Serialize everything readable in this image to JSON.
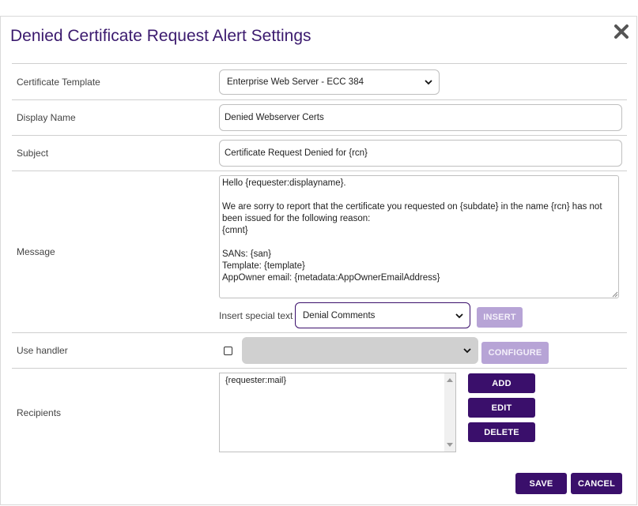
{
  "dialog": {
    "title": "Denied Certificate Request Alert Settings"
  },
  "fields": {
    "certificate_template": {
      "label": "Certificate Template",
      "value": "Enterprise Web Server - ECC 384"
    },
    "display_name": {
      "label": "Display Name",
      "value": "Denied Webserver Certs"
    },
    "subject": {
      "label": "Subject",
      "value": "Certificate Request Denied for {rcn}"
    },
    "message": {
      "label": "Message",
      "value": "Hello {requester:displayname}.\n\nWe are sorry to report that the certificate you requested on {subdate} in the name {rcn} has not been issued for the following reason:\n{cmnt}\n\nSANs: {san}\nTemplate: {template}\nAppOwner email: {metadata:AppOwnerEmailAddress}"
    },
    "insert_special": {
      "label": "Insert special text",
      "value": "Denial Comments",
      "button": "INSERT"
    },
    "use_handler": {
      "label": "Use handler",
      "checked": false,
      "value": "",
      "button": "CONFIGURE"
    },
    "recipients": {
      "label": "Recipients",
      "items": [
        "{requester:mail}"
      ],
      "add": "ADD",
      "edit": "EDIT",
      "delete": "DELETE"
    }
  },
  "footer": {
    "save": "SAVE",
    "cancel": "CANCEL"
  },
  "icons": {
    "close": "close-icon",
    "dropdown": "chevron-down-icon"
  },
  "colors": {
    "title": "#3b1a6e",
    "primary_button": "#3a0f6b",
    "disabled_button": "#b7a4d6"
  }
}
